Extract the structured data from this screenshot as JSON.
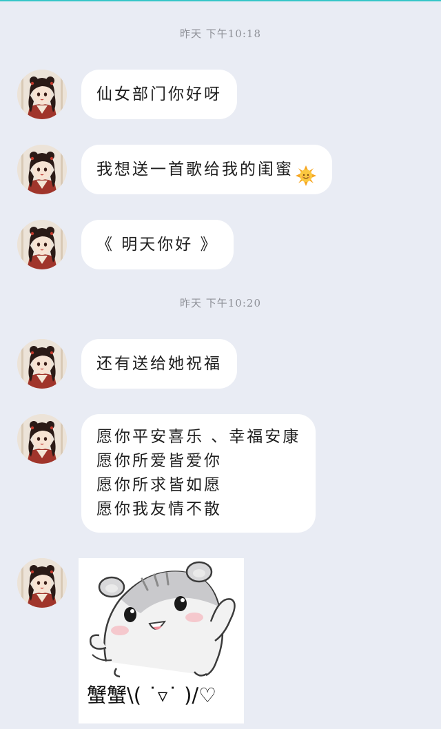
{
  "theme": {
    "background": "#e9ecf4",
    "accent_line": "#35c6c8",
    "bubble": "#ffffff",
    "timestamp_color": "#8e9097"
  },
  "timestamps": [
    "昨天 下午10:18",
    "昨天 下午10:20"
  ],
  "messages": [
    {
      "sender": "avatar",
      "text": "仙女部门你好呀"
    },
    {
      "sender": "avatar",
      "text": "我想送一首歌给我的闺蜜",
      "emoji": "sun-emoji"
    },
    {
      "sender": "avatar",
      "text": "《 明天你好 》"
    },
    {
      "sender": "avatar",
      "text": "还有送给她祝福"
    },
    {
      "sender": "avatar",
      "lines": [
        "愿你平安喜乐 、幸福安康",
        "愿你所爱皆爱你",
        "愿你所求皆如愿",
        "愿你我友情不散"
      ]
    },
    {
      "sender": "avatar",
      "sticker": "hamster-sticker",
      "caption": "蟹蟹\\( ˙▿˙ )/♡"
    }
  ]
}
